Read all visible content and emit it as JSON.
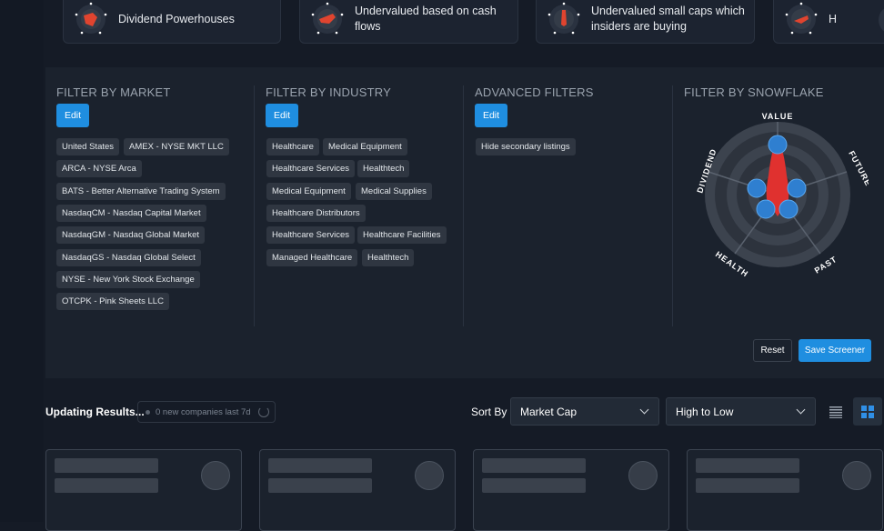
{
  "top_cards": [
    {
      "label": "Dividend Powerhouses"
    },
    {
      "label": "Undervalued based on cash flows"
    },
    {
      "label": "Undervalued small caps which insiders are buying"
    },
    {
      "label": "H"
    }
  ],
  "filters": {
    "market": {
      "title": "FILTER BY MARKET",
      "edit_label": "Edit",
      "chips": [
        "United States",
        "AMEX - NYSE MKT LLC",
        "ARCA - NYSE Arca",
        "BATS - Better Alternative Trading System",
        "NasdaqCM - Nasdaq Capital Market",
        "NasdaqGM - Nasdaq Global Market",
        "NasdaqGS - Nasdaq Global Select",
        "NYSE - New York Stock Exchange",
        "OTCPK - Pink Sheets LLC"
      ]
    },
    "industry": {
      "title": "FILTER BY INDUSTRY",
      "edit_label": "Edit",
      "chips": [
        "Healthcare",
        "Medical Equipment",
        "Healthcare Services",
        "Healthtech",
        "Medical Equipment",
        "Medical Supplies",
        "Healthcare Distributors",
        "Healthcare Services",
        "Healthcare Facilities",
        "Managed Healthcare",
        "Healthtech"
      ]
    },
    "advanced": {
      "title": "ADVANCED FILTERS",
      "edit_label": "Edit",
      "chips": [
        "Hide secondary listings"
      ]
    },
    "snowflake": {
      "title": "FILTER BY SNOWFLAKE",
      "axes": [
        "VALUE",
        "FUTURE",
        "PAST",
        "HEALTH",
        "DIVIDEND"
      ]
    },
    "reset_label": "Reset",
    "save_label": "Save Screener"
  },
  "results": {
    "status": "Updating Results...",
    "new_companies": "0 new companies last 7d",
    "sort_label": "Sort By",
    "sort_field": "Market Cap",
    "sort_order": "High to Low"
  },
  "colors": {
    "accent": "#1f8ee0",
    "danger": "#e0312f",
    "panel": "#1b222d",
    "chip": "#2f3641"
  }
}
